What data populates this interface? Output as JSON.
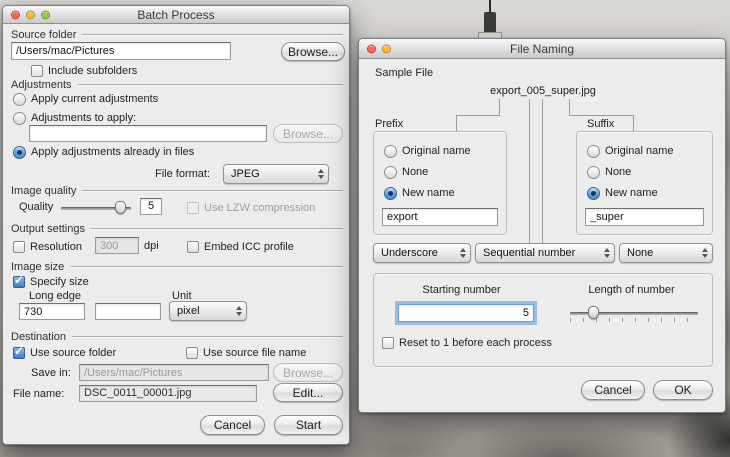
{
  "icons": {
    "checkmark": "✓"
  },
  "batch": {
    "title": "Batch Process",
    "source": {
      "section_label": "Source folder",
      "path_value": "/Users/mac/Pictures",
      "browse_label": "Browse...",
      "include_subfolders_label": "Include subfolders"
    },
    "adjustments": {
      "section_label": "Adjustments",
      "apply_current_label": "Apply current adjustments",
      "to_apply_label": "Adjustments to apply:",
      "to_apply_value": "",
      "browse_label": "Browse...",
      "apply_in_files_label": "Apply adjustments already in files",
      "file_format_label": "File format:",
      "file_format_value": "JPEG"
    },
    "image_quality": {
      "section_label": "Image quality",
      "quality_label": "Quality",
      "quality_value": "5",
      "lzw_label": "Use LZW compression"
    },
    "output": {
      "section_label": "Output settings",
      "resolution_label": "Resolution",
      "resolution_value": "300",
      "dpi_label": "dpi",
      "icc_label": "Embed ICC profile"
    },
    "size": {
      "section_label": "Image size",
      "specify_label": "Specify size",
      "long_edge_label": "Long edge",
      "unit_label": "Unit",
      "long_edge_value": "730",
      "short_edge_value": "",
      "unit_value": "pixel"
    },
    "destination": {
      "section_label": "Destination",
      "use_source_folder_label": "Use source folder",
      "use_source_name_label": "Use source file name",
      "save_in_label": "Save in:",
      "save_in_value": "/Users/mac/Pictures",
      "browse_label": "Browse...",
      "file_name_label": "File name:",
      "file_name_value": "DSC_0011_00001.jpg",
      "edit_label": "Edit..."
    },
    "cancel_label": "Cancel",
    "start_label": "Start"
  },
  "naming": {
    "title": "File Naming",
    "sample_file_label": "Sample File",
    "sample_value": "export_005_super.jpg",
    "prefix": {
      "box_label": "Prefix",
      "original_label": "Original name",
      "none_label": "None",
      "new_label": "New name",
      "field_value": "export"
    },
    "suffix": {
      "box_label": "Suffix",
      "original_label": "Original name",
      "none_label": "None",
      "new_label": "New name",
      "field_value": "_super"
    },
    "separator_left_value": "Underscore",
    "separator_middle_value": "Sequential number",
    "separator_right_value": "None",
    "numbering": {
      "starting_label": "Starting number",
      "starting_value": "5",
      "length_label": "Length of number",
      "reset_label": "Reset to 1 before each process"
    },
    "cancel_label": "Cancel",
    "ok_label": "OK"
  }
}
